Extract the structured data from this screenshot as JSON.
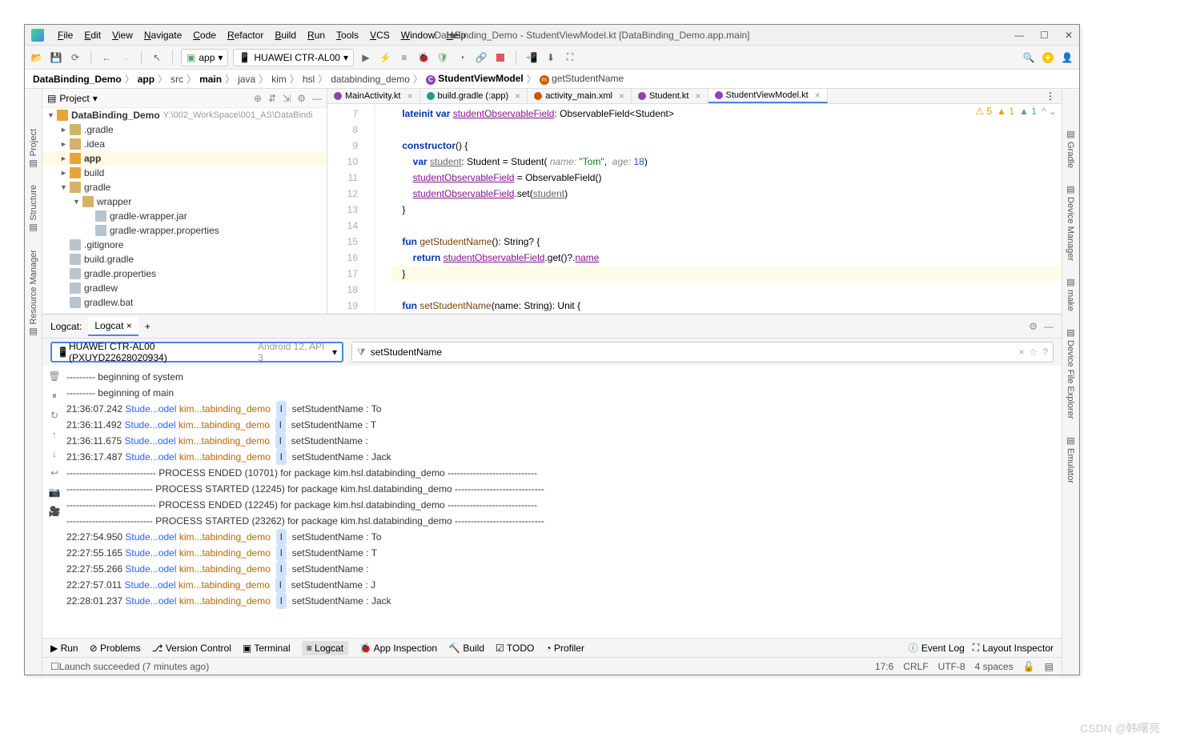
{
  "title": "DataBinding_Demo - StudentViewModel.kt [DataBinding_Demo.app.main]",
  "menu": [
    "File",
    "Edit",
    "View",
    "Navigate",
    "Code",
    "Refactor",
    "Build",
    "Run",
    "Tools",
    "VCS",
    "Window",
    "Help"
  ],
  "toolbar": {
    "run_config": "app",
    "device": "HUAWEI CTR-AL00"
  },
  "breadcrumb": [
    "DataBinding_Demo",
    "app",
    "src",
    "main",
    "java",
    "kim",
    "hsl",
    "databinding_demo",
    "StudentViewModel",
    "getStudentName"
  ],
  "left_tabs": [
    "Project",
    "Structure",
    "Resource Manager"
  ],
  "right_tabs": [
    "Gradle",
    "Device Manager"
  ],
  "right_tabs2": [
    "make",
    "Device File Explorer",
    "Emulator"
  ],
  "project": {
    "header": "Project",
    "root": {
      "name": "DataBinding_Demo",
      "path": "Y:\\002_WorkSpace\\001_AS\\DataBindi"
    },
    "nodes": [
      {
        "indent": 1,
        "exp": "►",
        "ico": "folder",
        "name": ".gradle"
      },
      {
        "indent": 1,
        "exp": "►",
        "ico": "folder",
        "name": ".idea"
      },
      {
        "indent": 1,
        "exp": "►",
        "ico": "folder o",
        "name": "app",
        "sel": true
      },
      {
        "indent": 1,
        "exp": "►",
        "ico": "folder o",
        "name": "build"
      },
      {
        "indent": 1,
        "exp": "▼",
        "ico": "folder",
        "name": "gradle"
      },
      {
        "indent": 2,
        "exp": "▼",
        "ico": "folder",
        "name": "wrapper"
      },
      {
        "indent": 3,
        "exp": "",
        "ico": "file",
        "name": "gradle-wrapper.jar"
      },
      {
        "indent": 3,
        "exp": "",
        "ico": "file",
        "name": "gradle-wrapper.properties"
      },
      {
        "indent": 1,
        "exp": "",
        "ico": "file",
        "name": ".gitignore"
      },
      {
        "indent": 1,
        "exp": "",
        "ico": "file",
        "name": "build.gradle"
      },
      {
        "indent": 1,
        "exp": "",
        "ico": "file",
        "name": "gradle.properties"
      },
      {
        "indent": 1,
        "exp": "",
        "ico": "file",
        "name": "gradlew"
      },
      {
        "indent": 1,
        "exp": "",
        "ico": "file",
        "name": "gradlew.bat"
      }
    ]
  },
  "editor": {
    "tabs": [
      {
        "name": "MainActivity.kt",
        "icon": "kt"
      },
      {
        "name": "build.gradle (:app)",
        "icon": "gradle"
      },
      {
        "name": "activity_main.xml",
        "icon": "xml"
      },
      {
        "name": "Student.kt",
        "icon": "kt"
      },
      {
        "name": "StudentViewModel.kt",
        "icon": "kt",
        "active": true
      }
    ],
    "inspection": {
      "warn5": "5",
      "warn1a": "1",
      "warn1b": "1"
    },
    "lines_start": 7,
    "lines": [
      {
        "n": 7,
        "html": "    <span class='kw'>lateinit var</span> <span class='ul purple'>studentObservableField</span>: ObservableField&lt;Student&gt;"
      },
      {
        "n": 8,
        "html": ""
      },
      {
        "n": 9,
        "html": "    <span class='kw'>constructor</span>() {"
      },
      {
        "n": 10,
        "html": "        <span class='kw'>var</span> <span class='ul gray'>student</span>: Student = Student( <span class='param'>name:</span> <span class='str'>\"Tom\"</span>,  <span class='param'>age:</span> <span class='num'>18</span>)"
      },
      {
        "n": 11,
        "html": "        <span class='ul purple'>studentObservableField</span> = ObservableField()"
      },
      {
        "n": 12,
        "html": "        <span class='ul purple'>studentObservableField</span>.set(<span class='ul gray'>student</span>)"
      },
      {
        "n": 13,
        "html": "    }"
      },
      {
        "n": 14,
        "html": ""
      },
      {
        "n": 15,
        "html": "    <span class='kw'>fun</span> <span class='fn'>getStudentName</span>(): String? {"
      },
      {
        "n": 16,
        "html": "        <span class='kw'>return</span> <span class='ul purple'>studentObservableField</span>.get()?.<span class='ul purple'>name</span>"
      },
      {
        "n": 17,
        "html": "    }",
        "hl": true
      },
      {
        "n": 18,
        "html": ""
      },
      {
        "n": 19,
        "html": "    <span class='kw'>fun</span> <span class='fn'>setStudentName</span>(name: String): Unit {"
      }
    ]
  },
  "logcat": {
    "label": "Logcat:",
    "tab": "Logcat",
    "device": {
      "name": "HUAWEI CTR-AL00 (PXUYD22628020934)",
      "suffix": "Android 12, API 3"
    },
    "filter": "setStudentName",
    "lines": [
      "--------- beginning of system",
      "--------- beginning of main",
      "21:36:07.242 |Stude...odel| kim...tabinding_demo |[I]| setStudentName : To",
      "21:36:11.492 |Stude...odel| kim...tabinding_demo |[I]| setStudentName : T",
      "21:36:11.675 |Stude...odel| kim...tabinding_demo |[I]| setStudentName :",
      "21:36:17.487 |Stude...odel| kim...tabinding_demo |[I]| setStudentName : Jack",
      "---------------------------- PROCESS ENDED (10701) for package kim.hsl.databinding_demo ----------------------------",
      "--------------------------- PROCESS STARTED (12245) for package kim.hsl.databinding_demo ----------------------------",
      "---------------------------- PROCESS ENDED (12245) for package kim.hsl.databinding_demo ----------------------------",
      "--------------------------- PROCESS STARTED (23262) for package kim.hsl.databinding_demo ----------------------------",
      "22:27:54.950 |Stude...odel| kim...tabinding_demo |[I]| setStudentName : To",
      "22:27:55.165 |Stude...odel| kim...tabinding_demo |[I]| setStudentName : T",
      "22:27:55.266 |Stude...odel| kim...tabinding_demo |[I]| setStudentName :",
      "22:27:57.011 |Stude...odel| kim...tabinding_demo |[I]| setStudentName : J",
      "22:28:01.237 |Stude...odel| kim...tabinding_demo |[I]| setStudentName : Jack"
    ]
  },
  "bottom_tabs": [
    "Run",
    "Problems",
    "Version Control",
    "Terminal",
    "Logcat",
    "App Inspection",
    "Build",
    "TODO",
    "Profiler"
  ],
  "bottom_right": [
    "Event Log",
    "Layout Inspector"
  ],
  "status": {
    "msg": "Launch succeeded (7 minutes ago)",
    "pos": "17:6",
    "eol": "CRLF",
    "enc": "UTF-8",
    "indent": "4 spaces"
  },
  "watermark": "CSDN @韩曙亮"
}
